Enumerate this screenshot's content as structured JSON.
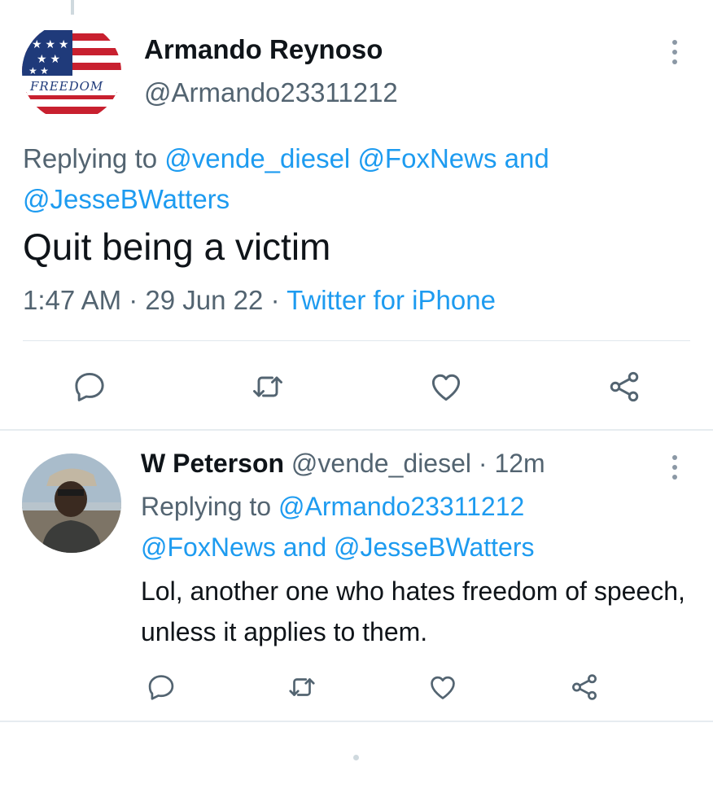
{
  "main_tweet": {
    "author_name": "Armando Reynoso",
    "author_handle": "@Armando23311212",
    "avatar_text": "FREEDOM",
    "replying_prefix": "Replying to ",
    "replying_handles": [
      "@vende_diesel",
      "@FoxNews",
      "@JesseBWatters"
    ],
    "replying_joiner": "and",
    "text": "Quit being a victim",
    "time": "1:47 AM",
    "date": "29 Jun 22",
    "source": "Twitter for iPhone",
    "meta_sep": "·"
  },
  "reply_tweet": {
    "author_name": "W Peterson",
    "author_handle": "@vende_diesel",
    "time_sep": "·",
    "time": "12m",
    "replying_prefix": "Replying to ",
    "replying_handles": [
      "@Armando23311212",
      "@FoxNews",
      "@JesseBWatters"
    ],
    "replying_joiner": "and",
    "text": "Lol, another one who hates freedom of speech, unless it applies to them."
  },
  "icons": {
    "reply": "reply-icon",
    "retweet": "retweet-icon",
    "like": "heart-icon",
    "share": "share-icon",
    "more": "more-vertical-icon"
  },
  "colors": {
    "link": "#1d9bf0",
    "secondary_text": "#536471",
    "primary_text": "#0f1419",
    "icon": "#536471"
  }
}
